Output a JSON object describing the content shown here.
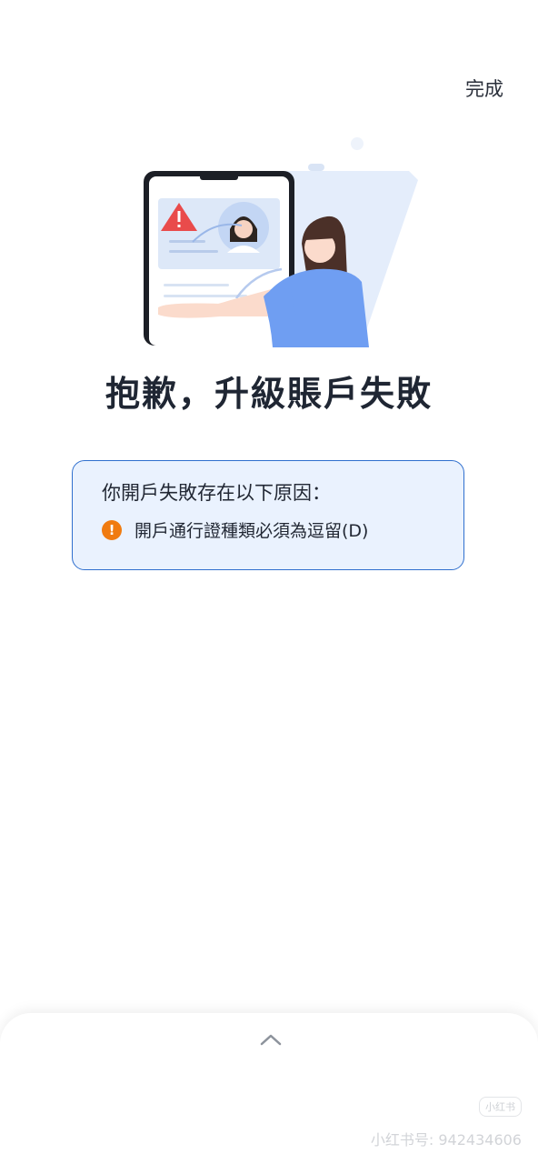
{
  "header": {
    "done_label": "完成"
  },
  "title": "抱歉，升級賬戶失敗",
  "reasons": {
    "heading": "你開戶失敗存在以下原因：",
    "items": [
      {
        "icon": "warning-icon",
        "text": "開戶通行證種類必須為逗留(D)"
      }
    ]
  },
  "watermark": {
    "badge": "小红书",
    "text": "小红书号: 942434606"
  },
  "colors": {
    "accent_border": "#2f6fce",
    "box_background": "#eaf2fe",
    "warning": "#f07b10",
    "alert_red": "#e94b4b"
  }
}
